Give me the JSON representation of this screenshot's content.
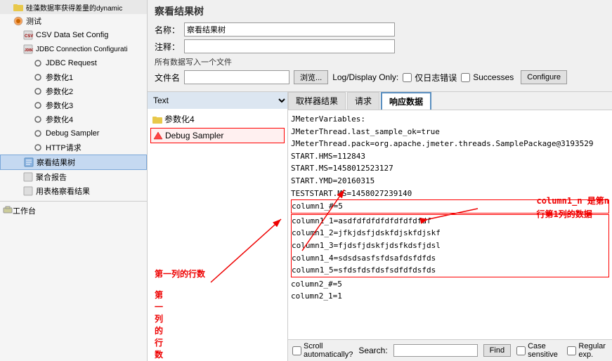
{
  "sidebar": {
    "items": [
      {
        "id": "dynamic",
        "label": "硅藻数据率获得差量的dynamic",
        "indent": 1,
        "type": "folder",
        "icon": "folder"
      },
      {
        "id": "test",
        "label": "测试",
        "indent": 1,
        "type": "test",
        "icon": "test"
      },
      {
        "id": "csv",
        "label": "CSV Data Set Config",
        "indent": 2,
        "type": "csv",
        "icon": "csv"
      },
      {
        "id": "jdbc-config",
        "label": "JDBC Connection Configurati",
        "indent": 2,
        "type": "jdbc",
        "icon": "jdbc"
      },
      {
        "id": "jdbc-req",
        "label": "JDBC Request",
        "indent": 3,
        "type": "item",
        "icon": "circle"
      },
      {
        "id": "param1",
        "label": "参数化1",
        "indent": 3,
        "type": "item",
        "icon": "circle"
      },
      {
        "id": "param2",
        "label": "参数化2",
        "indent": 3,
        "type": "item",
        "icon": "circle"
      },
      {
        "id": "param3",
        "label": "参数化3",
        "indent": 3,
        "type": "item",
        "icon": "circle"
      },
      {
        "id": "param4",
        "label": "参数化4",
        "indent": 3,
        "type": "item",
        "icon": "circle"
      },
      {
        "id": "debug",
        "label": "Debug Sampler",
        "indent": 3,
        "type": "item",
        "icon": "circle"
      },
      {
        "id": "http",
        "label": "HTTP请求",
        "indent": 3,
        "type": "item",
        "icon": "circle"
      },
      {
        "id": "view-results",
        "label": "察看结果树",
        "indent": 2,
        "type": "results",
        "icon": "results",
        "selected": true
      },
      {
        "id": "aggregate",
        "label": "聚合报告",
        "indent": 2,
        "type": "item",
        "icon": "item"
      },
      {
        "id": "table-results",
        "label": "用表格察看结果",
        "indent": 2,
        "type": "item",
        "icon": "item"
      }
    ],
    "workbench": "工作台"
  },
  "header": {
    "title": "察看结果树",
    "name_label": "名称：",
    "name_value": "察看结果树",
    "comment_label": "注释：",
    "comment_value": "",
    "file_note": "所有数据写入一个文件",
    "file_label": "文件名",
    "file_value": "",
    "browse_label": "浏览...",
    "log_label": "Log/Display Only:",
    "error_label": "仅日志错误",
    "successes_label": "Successes",
    "configure_label": "Configure"
  },
  "left_panel": {
    "dropdown_value": "Text",
    "items": [
      {
        "id": "param4-node",
        "label": "参数化4",
        "icon": "folder",
        "selected": false
      },
      {
        "id": "debug-node",
        "label": "Debug Sampler",
        "icon": "triangle",
        "selected": true
      }
    ]
  },
  "tabs": [
    {
      "id": "sampler-result",
      "label": "取样器结果",
      "active": false
    },
    {
      "id": "request",
      "label": "请求",
      "active": false
    },
    {
      "id": "response-data",
      "label": "响应数据",
      "active": true
    }
  ],
  "response_content": [
    "JMeterVariables:",
    "JMeterThread.last_sample_ok=true",
    "JMeterThread.pack=org.apache.jmeter.threads.SamplePackage@3193529",
    "START.HMS=112843",
    "START.MS=1458012523127",
    "START.YMD=20160315",
    "TESTSTART.MS=1458027239140",
    "column1_#=5",
    "column1_1=asdfdfdfdfdfdfdfdfdf",
    "column1_2=jfkjdsfjdskfdjskfdjskf",
    "column1_3=fjdsfjdskfjdsfkdsfjdsl",
    "column1_4=sdsdsasfsfdsafdsfdfds",
    "column1_5=sfdsfdsfdsfsdfdfdsfds",
    "column2_#=5",
    "column2_1=1"
  ],
  "annotations": {
    "first_col_rows": "第一列的行数",
    "col_n_data": "column1_n 是第n\n行第1列的数据"
  },
  "bottom_bar": {
    "scroll_label": "Scroll automatically?",
    "search_label": "Search:",
    "search_placeholder": "",
    "find_label": "Find",
    "case_sensitive_label": "Case sensitive",
    "regular_exp_label": "Regular exp."
  }
}
